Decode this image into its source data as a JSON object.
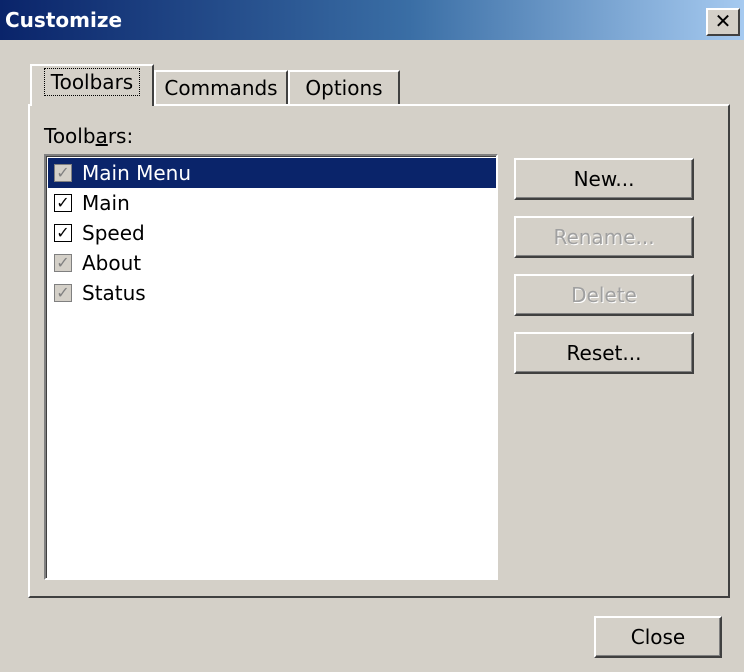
{
  "window": {
    "title": "Customize",
    "close_glyph": "✕"
  },
  "tabs": [
    {
      "label": "Toolbars",
      "active": true
    },
    {
      "label": "Commands",
      "active": false
    },
    {
      "label": "Options",
      "active": false
    }
  ],
  "toolbars_label": "Toolbars:",
  "toolbars": [
    {
      "label": "Main Menu",
      "checked": true,
      "disabled": true,
      "selected": true
    },
    {
      "label": "Main",
      "checked": true,
      "disabled": false,
      "selected": false
    },
    {
      "label": "Speed",
      "checked": true,
      "disabled": false,
      "selected": false
    },
    {
      "label": "About",
      "checked": true,
      "disabled": true,
      "selected": false
    },
    {
      "label": "Status",
      "checked": true,
      "disabled": true,
      "selected": false
    }
  ],
  "buttons": {
    "new": "New...",
    "rename": "Rename...",
    "delete": "Delete",
    "reset": "Reset...",
    "close": "Close"
  },
  "colors": {
    "title_start": "#0a246a",
    "title_end": "#a6caf0",
    "selection": "#0a246a",
    "face": "#d4d0c8"
  },
  "icons": {
    "check": "check-mark-icon",
    "close": "close-icon"
  }
}
